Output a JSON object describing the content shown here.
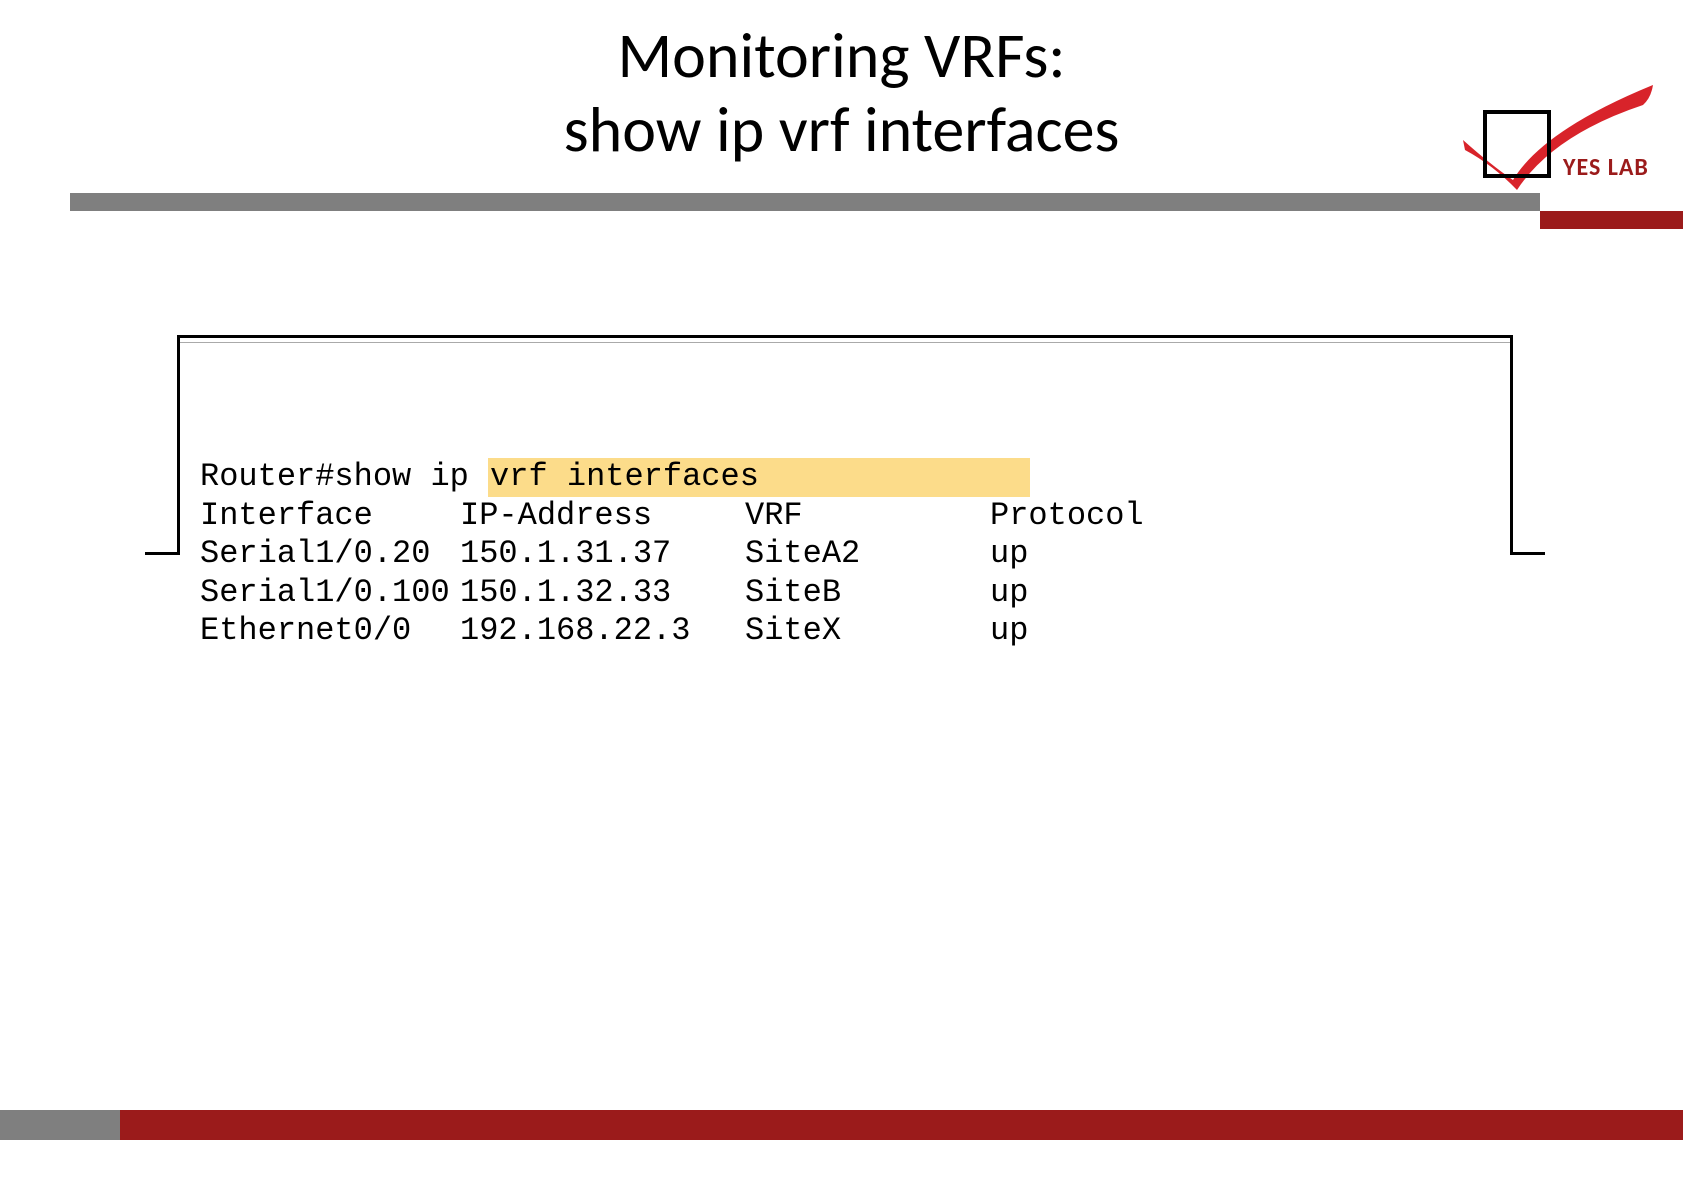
{
  "title": {
    "line1": "Monitoring VRFs:",
    "line2": "show ip vrf interfaces"
  },
  "logo": {
    "text": "YES LAB"
  },
  "cli": {
    "prompt_prefix": "Router#show ip ",
    "highlighted": "vrf interfaces              ",
    "headers": {
      "interface": "Interface",
      "ip": "IP-Address",
      "vrf": "VRF",
      "protocol": "Protocol"
    },
    "rows": [
      {
        "interface": "Serial1/0.20",
        "ip": "150.1.31.37",
        "vrf": "SiteA2",
        "protocol": "up"
      },
      {
        "interface": "Serial1/0.100",
        "ip": "150.1.32.33",
        "vrf": "SiteB",
        "protocol": "up"
      },
      {
        "interface": "Ethernet0/0",
        "ip": "192.168.22.3",
        "vrf": "SiteX",
        "protocol": "up"
      }
    ]
  }
}
